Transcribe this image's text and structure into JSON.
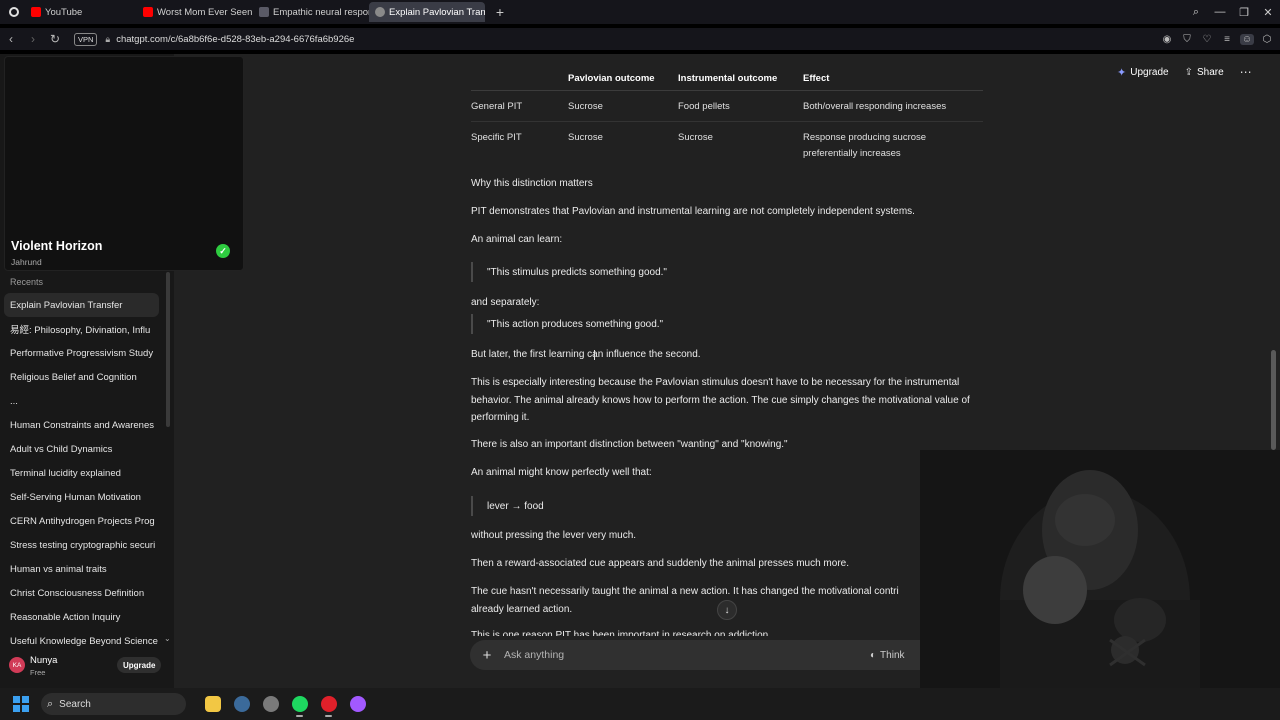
{
  "browser": {
    "tabs": [
      {
        "label": "YouTube",
        "color": "#ff0000",
        "active": false
      },
      {
        "label": "Worst Mom Ever Seen on",
        "color": "#ff0000",
        "active": false
      },
      {
        "label": "Empathic neural response",
        "color": "#5a5a66",
        "active": false
      },
      {
        "label": "Explain Pavlovian Transfer",
        "color": "#8a8a8a",
        "active": true
      }
    ],
    "close_glyph": "✕",
    "new_tab_glyph": "+",
    "vpn_label": "VPN",
    "url": "chatgpt.com/c/6a8b6f6e-d528-83eb-a294-6676fa6b926e"
  },
  "sidebar": {
    "card": {
      "title": "Violent Horizon",
      "subtitle": "Jahrund"
    },
    "recents_label": "Recents",
    "items": [
      {
        "label": "Explain Pavlovian Transfer"
      },
      {
        "label": "易經: Philosophy, Divination, Influ"
      },
      {
        "label": "Performative Progressivism Study"
      },
      {
        "label": "Religious Belief and Cognition"
      },
      {
        "label": "..."
      },
      {
        "label": "Human Constraints and Awarenes"
      },
      {
        "label": "Adult vs Child Dynamics"
      },
      {
        "label": "Terminal lucidity explained"
      },
      {
        "label": "Self-Serving Human Motivation"
      },
      {
        "label": "CERN Antihydrogen Projects Prog"
      },
      {
        "label": "Stress testing cryptographic securi"
      },
      {
        "label": "Human vs animal traits"
      },
      {
        "label": "Christ Consciousness Definition"
      },
      {
        "label": "Reasonable Action Inquiry"
      },
      {
        "label": "Useful Knowledge Beyond Science"
      }
    ],
    "user": {
      "initials": "KA",
      "name": "Nunya",
      "plan": "Free",
      "upgrade_label": "Upgrade"
    }
  },
  "header": {
    "upgrade_label": "Upgrade",
    "share_label": "Share"
  },
  "table": {
    "headers": [
      "",
      "Pavlovian outcome",
      "Instrumental outcome",
      "Effect"
    ],
    "rows": [
      [
        "General PIT",
        "Sucrose",
        "Food pellets",
        "Both/overall responding increases"
      ],
      [
        "Specific PIT",
        "Sucrose",
        "Sucrose",
        "Response producing sucrose preferentially increases"
      ]
    ]
  },
  "conversation": {
    "heading": "Why this distinction matters",
    "p1": "PIT demonstrates that Pavlovian and instrumental learning are not completely independent systems.",
    "p2": "An animal can learn:",
    "q1": "\"This stimulus predicts something good.\"",
    "p3": "and separately:",
    "q2": "\"This action produces something good.\"",
    "p4": "But later, the first learning can influence the second.",
    "p5": "This is especially interesting because the Pavlovian stimulus doesn't have to be necessary for the instrumental behavior. The animal already knows how to perform the action. The cue simply changes the motivational value of performing it.",
    "p6": "There is also an important distinction between \"wanting\" and \"knowing.\"",
    "p7": "An animal might know perfectly well that:",
    "q3": "lever → food",
    "p8": "without pressing the lever very much.",
    "p9": "Then a reward-associated cue appears and suddenly the animal presses much more.",
    "p10": "The cue hasn't necessarily taught the animal a new action. It has changed the motivational contri",
    "p10b": "already learned action.",
    "p11": "This is one reason PIT has been important in research on addiction."
  },
  "composer": {
    "placeholder": "Ask anything",
    "think_label": "Think"
  },
  "taskbar": {
    "search_label": "Search",
    "apps": [
      {
        "name": "file-explorer-icon",
        "color": "#f2c744"
      },
      {
        "name": "steam-icon",
        "color": "#3b6a9a"
      },
      {
        "name": "chrome-icon",
        "color": "#7a7a7a"
      },
      {
        "name": "spotify-icon",
        "color": "#1ed760"
      },
      {
        "name": "opera-icon",
        "color": "#e0202a"
      },
      {
        "name": "opera-gx-icon",
        "color": "#a259ff"
      }
    ]
  }
}
